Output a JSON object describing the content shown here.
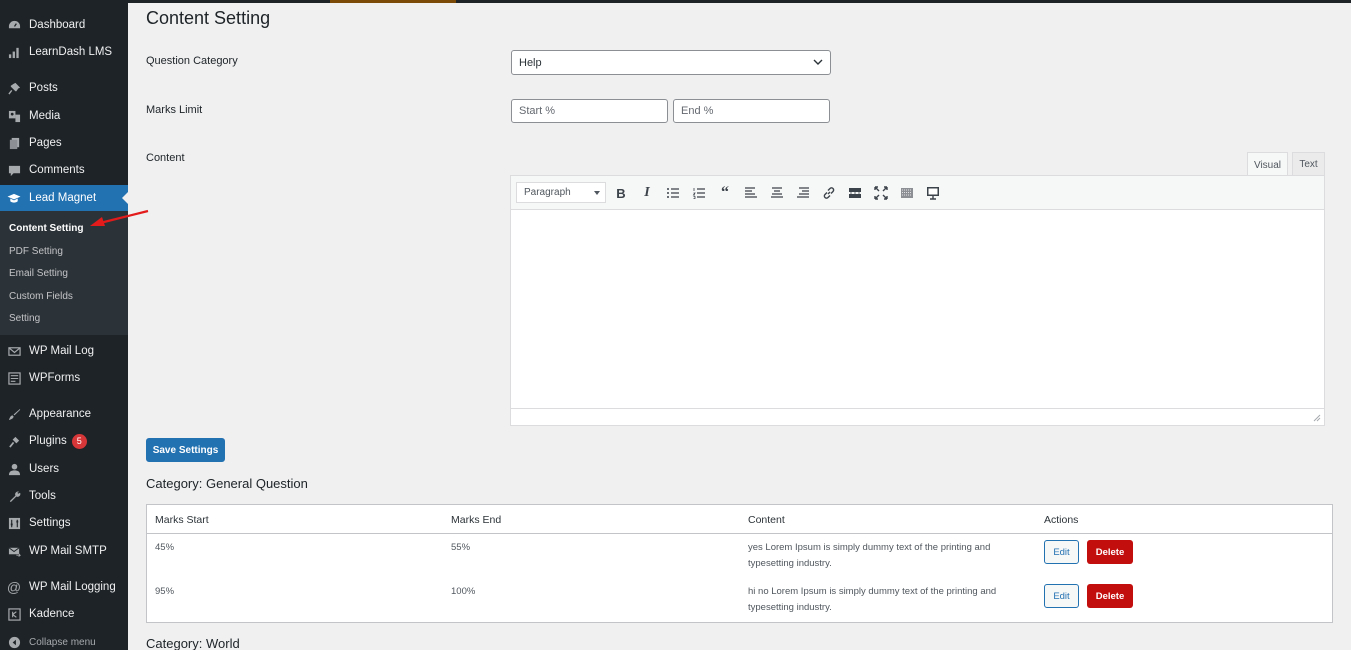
{
  "sidebar": {
    "items": [
      {
        "label": "Dashboard",
        "icon": "dashboard-icon"
      },
      {
        "label": "LearnDash LMS",
        "icon": "learndash-icon"
      },
      {
        "label": "Posts",
        "icon": "pin-icon"
      },
      {
        "label": "Media",
        "icon": "media-icon"
      },
      {
        "label": "Pages",
        "icon": "pages-icon"
      },
      {
        "label": "Comments",
        "icon": "comment-icon"
      },
      {
        "label": "Lead Magnet",
        "icon": "graduation-cap-icon",
        "active": true
      },
      {
        "label": "WP Mail Log",
        "icon": "envelope-icon"
      },
      {
        "label": "WPForms",
        "icon": "forms-icon"
      },
      {
        "label": "Appearance",
        "icon": "brush-icon"
      },
      {
        "label": "Plugins",
        "icon": "plug-icon",
        "badge": "5"
      },
      {
        "label": "Users",
        "icon": "user-icon"
      },
      {
        "label": "Tools",
        "icon": "wrench-icon"
      },
      {
        "label": "Settings",
        "icon": "sliders-icon"
      },
      {
        "label": "WP Mail SMTP",
        "icon": "mail-send-icon"
      },
      {
        "label": "WP Mail Logging",
        "icon": "at-icon"
      },
      {
        "label": "Kadence",
        "icon": "kadence-icon"
      }
    ],
    "submenu": [
      {
        "label": "Content Setting",
        "current": true
      },
      {
        "label": "PDF Setting"
      },
      {
        "label": "Email Setting"
      },
      {
        "label": "Custom Fields"
      },
      {
        "label": "Setting"
      }
    ],
    "collapse_label": "Collapse menu"
  },
  "page": {
    "title": "Content Setting",
    "fields": {
      "category_label": "Question Category",
      "category_value": "Help",
      "marks_label": "Marks Limit",
      "start_placeholder": "Start %",
      "end_placeholder": "End %",
      "content_label": "Content"
    },
    "editor": {
      "tab_visual": "Visual",
      "tab_text": "Text",
      "format_value": "Paragraph",
      "toolbar": [
        "bold",
        "italic",
        "bullet-list",
        "numbered-list",
        "blockquote",
        "align-left",
        "align-center",
        "align-right",
        "link",
        "read-more",
        "fullscreen",
        "toolbar-toggle",
        "preview"
      ]
    },
    "save_label": "Save Settings"
  },
  "categories": [
    {
      "heading": "Category: General Question",
      "columns": [
        "Marks Start",
        "Marks End",
        "Content",
        "Actions"
      ],
      "rows": [
        {
          "start": "45%",
          "end": "55%",
          "content_line1": "yes Lorem Ipsum is simply dummy text of the printing and",
          "content_line2": "typesetting industry.",
          "edit": "Edit",
          "delete": "Delete"
        },
        {
          "start": "95%",
          "end": "100%",
          "content_line1": "hi no Lorem Ipsum is simply dummy text of the printing and",
          "content_line2": "typesetting industry.",
          "edit": "Edit",
          "delete": "Delete"
        }
      ]
    },
    {
      "heading": "Category: World"
    }
  ],
  "colors": {
    "sidebar_bg": "#1d2327",
    "accent": "#2271b1",
    "delete": "#c30e0e",
    "badge": "#d63638"
  }
}
